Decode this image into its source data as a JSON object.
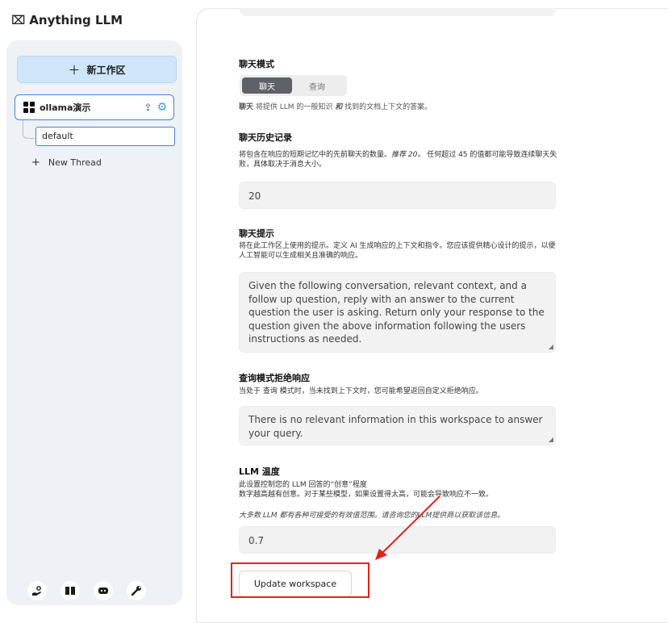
{
  "brand": {
    "logo": "⌧",
    "name": "Anything LLM"
  },
  "sidebar": {
    "new_workspace_label": "新工作区",
    "workspace": {
      "name": "ollama演示"
    },
    "threads": [
      {
        "label": "default"
      }
    ],
    "new_thread_label": "New Thread",
    "footer_icons": [
      "support-icon",
      "docs-icon",
      "discord-icon",
      "settings-wrench-icon"
    ]
  },
  "chat_mode": {
    "title": "聊天模式",
    "options": [
      "聊天",
      "查询"
    ],
    "selected": "聊天",
    "desc_strong": "聊天",
    "desc_a": " 将提供 LLM 的一般知识 ",
    "desc_em": "和",
    "desc_b": " 找到的文档上下文的答案。"
  },
  "chat_history": {
    "title": "聊天历史记录",
    "desc_a": "将包含在响应的短期记忆中的先前聊天的数量。",
    "desc_em": "推荐 20。",
    "desc_b": " 任何超过 45 的值都可能导致连续聊天失败，具体取决于消息大小。",
    "value": "20"
  },
  "chat_prompt": {
    "title": "聊天提示",
    "desc": "将在此工作区上使用的提示。定义 AI 生成响应的上下文和指令。您应该提供精心设计的提示，以便人工智能可以生成相关且准确的响应。",
    "value": "Given the following conversation, relevant context, and a follow up question, reply with an answer to the current question the user is asking. Return only your response to the question given the above information following the users instructions as needed."
  },
  "query_refusal": {
    "title": "查询模式拒绝响应",
    "desc": "当处于 查询 模式时，当未找到上下文时，您可能希望返回自定义拒绝响应。",
    "value": "There is no relevant information in this workspace to answer your query."
  },
  "llm_temperature": {
    "title": "LLM 温度",
    "desc_line1": "此设置控制您的 LLM 回答的“创意”程度",
    "desc_line2": "数字越高越有创意。对于某些模型，如果设置得太高，可能会导致响应不一致。",
    "note": "大多数 LLM 都有各种可接受的有效值范围。请咨询您的LLM提供商以获取该信息。",
    "value": "0.7"
  },
  "update_button_label": "Update workspace",
  "colors": {
    "accent": "#3d86d8",
    "annotation": "#e2231a",
    "new_ws_bg": "#cfe6fa"
  }
}
